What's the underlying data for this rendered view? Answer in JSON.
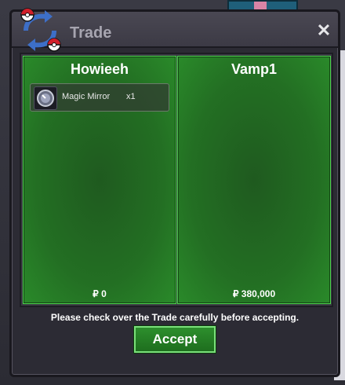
{
  "window": {
    "title": "Trade",
    "close_label": "✕"
  },
  "left_panel": {
    "player_name": "Howieeh",
    "items": [
      {
        "name": "Magic Mirror",
        "qty": "x1"
      }
    ],
    "money": "₽ 0"
  },
  "right_panel": {
    "player_name": "Vamp1",
    "items": [],
    "money": "₽ 380,000"
  },
  "notice": "Please check over the Trade carefully before accepting.",
  "accept_label": "Accept",
  "background": {
    "side_letter": "n"
  },
  "colors": {
    "panel_green": "#236f23",
    "panel_border": "#4cd64c",
    "accept_green": "#1e6e1e"
  },
  "icons": {
    "logo": "trade-swap-icon",
    "item": "magic-mirror-icon",
    "close": "close-icon"
  }
}
